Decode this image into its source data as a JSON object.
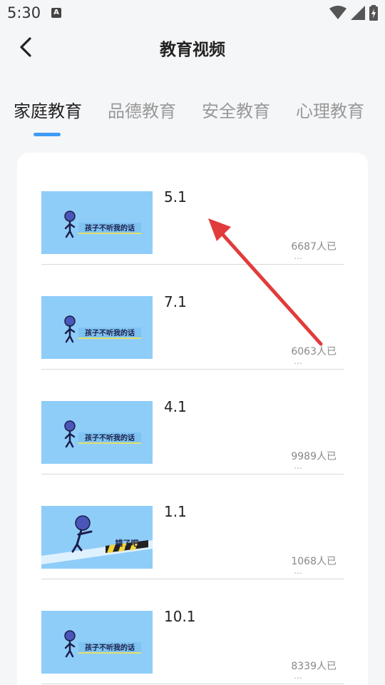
{
  "status": {
    "time": "5:30",
    "a_icon": "A"
  },
  "header": {
    "title": "教育视频"
  },
  "tabs": [
    {
      "label": "家庭教育"
    },
    {
      "label": "品德教育"
    },
    {
      "label": "安全教育"
    },
    {
      "label": "心理教育"
    }
  ],
  "videos": [
    {
      "title": "5.1",
      "count": "6687人已",
      "more": "…",
      "caption": "孩子不听我的话"
    },
    {
      "title": "7.1",
      "count": "6063人已",
      "more": "…",
      "caption": "孩子不听我的话"
    },
    {
      "title": "4.1",
      "count": "9989人已",
      "more": "…",
      "caption": "孩子不听我的话"
    },
    {
      "title": "1.1",
      "count": "1068人已",
      "more": "…",
      "caption": "错了吧"
    },
    {
      "title": "10.1",
      "count": "8339人已",
      "more": "…",
      "caption": "孩子不听我的话"
    }
  ],
  "colors": {
    "accent": "#3f9bf5",
    "arrow": "#e23b3b",
    "thumb_bg": "#8fcdf9"
  }
}
